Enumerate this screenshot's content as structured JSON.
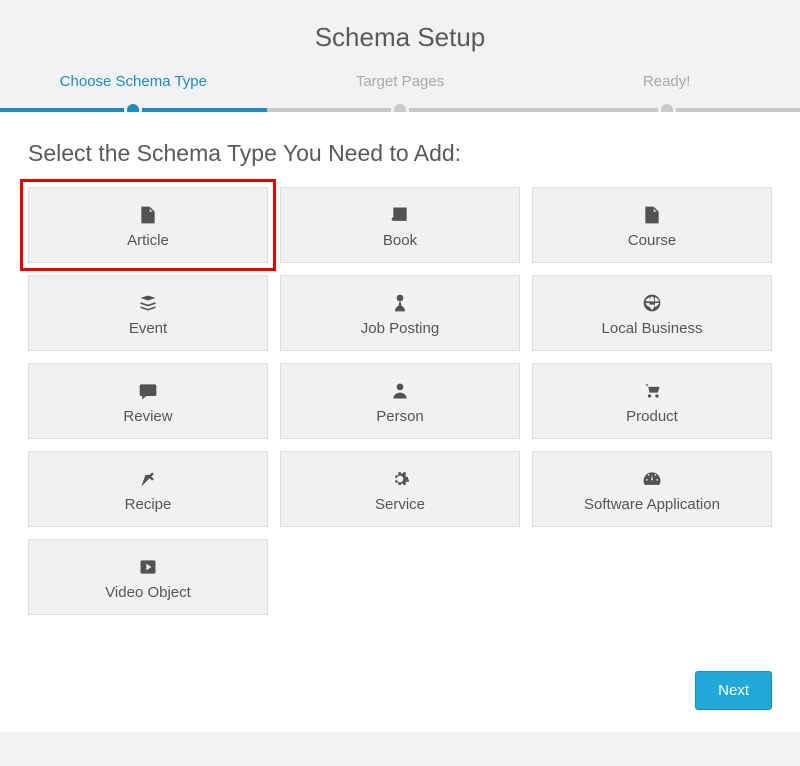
{
  "title": "Schema Setup",
  "steps": [
    {
      "label": "Choose Schema Type",
      "active": true
    },
    {
      "label": "Target Pages",
      "active": false
    },
    {
      "label": "Ready!",
      "active": false
    }
  ],
  "panel": {
    "heading": "Select the Schema Type You Need to Add:"
  },
  "schemas": [
    {
      "label": "Article",
      "icon": "file",
      "highlighted": true
    },
    {
      "label": "Book",
      "icon": "book",
      "highlighted": false
    },
    {
      "label": "Course",
      "icon": "file",
      "highlighted": false
    },
    {
      "label": "Event",
      "icon": "stack",
      "highlighted": false
    },
    {
      "label": "Job Posting",
      "icon": "user-tie",
      "highlighted": false
    },
    {
      "label": "Local Business",
      "icon": "globe",
      "highlighted": false
    },
    {
      "label": "Review",
      "icon": "comment",
      "highlighted": false
    },
    {
      "label": "Person",
      "icon": "user",
      "highlighted": false
    },
    {
      "label": "Product",
      "icon": "cart",
      "highlighted": false
    },
    {
      "label": "Recipe",
      "icon": "carrot",
      "highlighted": false
    },
    {
      "label": "Service",
      "icon": "gear",
      "highlighted": false
    },
    {
      "label": "Software Application",
      "icon": "dashboard",
      "highlighted": false
    },
    {
      "label": "Video Object",
      "icon": "play",
      "highlighted": false
    }
  ],
  "buttons": {
    "next": "Next"
  }
}
